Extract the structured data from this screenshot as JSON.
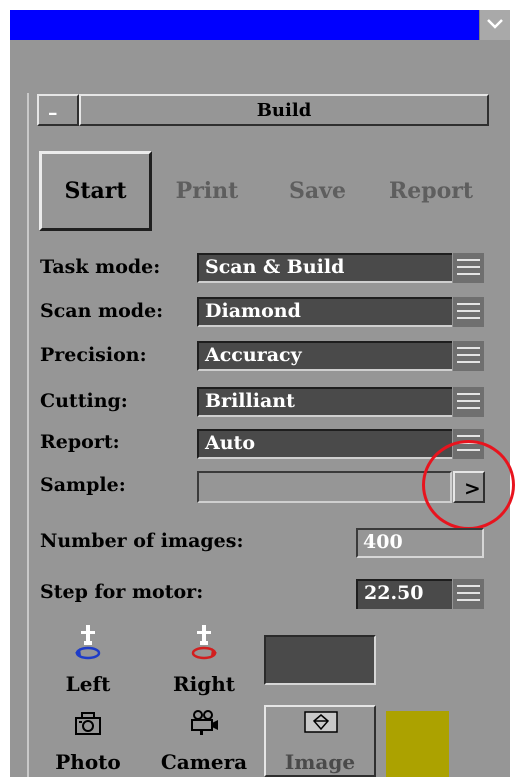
{
  "header": {
    "title": "Build",
    "collapse_label": "–"
  },
  "actions": [
    {
      "label": "Start",
      "enabled": true
    },
    {
      "label": "Print",
      "enabled": false
    },
    {
      "label": "Save",
      "enabled": false
    },
    {
      "label": "Report",
      "enabled": false
    }
  ],
  "settings": {
    "task_mode": {
      "label": "Task mode:",
      "value": "Scan & Build"
    },
    "scan_mode": {
      "label": "Scan mode:",
      "value": "Diamond"
    },
    "precision": {
      "label": "Precision:",
      "value": "Accuracy"
    },
    "cutting": {
      "label": "Cutting:",
      "value": "Brilliant"
    },
    "report": {
      "label": "Report:",
      "value": "Auto"
    },
    "sample": {
      "label": "Sample:",
      "value": "",
      "arrow": ">"
    }
  },
  "number_of_images": {
    "label": "Number of images:",
    "value": "400"
  },
  "step_for_motor": {
    "label": "Step for motor:",
    "value": "22.50"
  },
  "motor": {
    "left_label": "Left",
    "right_label": "Right",
    "left_icon": "rotate-left-icon",
    "right_icon": "rotate-right-icon"
  },
  "capture": {
    "photo_label": "Photo",
    "camera_label": "Camera",
    "image_label": "Image"
  },
  "colors": {
    "title_bar": "#0000ff",
    "panel": "#969696",
    "field": "#4a4a4a",
    "highlight_circle": "#e8141e",
    "accent_swatch": "#aca200",
    "rotate_left": "#1e3cc8",
    "rotate_right": "#d21e1e"
  }
}
